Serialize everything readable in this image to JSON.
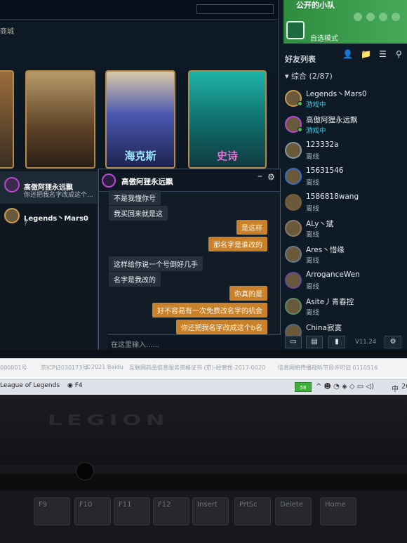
{
  "game": {
    "nav_label": "商城",
    "cards": [
      {
        "label": "",
        "color": "#c28c43"
      },
      {
        "label": "",
        "color": "#8a6b3b"
      },
      {
        "label": "海克斯",
        "color": "#5966b8"
      },
      {
        "label": "史诗",
        "color": "#1f9c96"
      }
    ]
  },
  "party": {
    "title": "公开的小队",
    "mode": "自选模式"
  },
  "friends": {
    "title": "好友列表",
    "group": "综合 (2/87)",
    "items": [
      {
        "name": "Legends丶Mars0",
        "status": "游戏中",
        "online": true
      },
      {
        "name": "高傲阿狸永远飘",
        "status": "游戏中",
        "online": true
      },
      {
        "name": "123332a",
        "status": "离线",
        "online": false
      },
      {
        "name": "15631546",
        "status": "离线",
        "online": false
      },
      {
        "name": "1586818wang",
        "status": "离线",
        "online": false
      },
      {
        "name": "ALy丶斌",
        "status": "离线",
        "online": false
      },
      {
        "name": "Ares丶惜缘",
        "status": "离线",
        "online": false
      },
      {
        "name": "ArroganceWen",
        "status": "离线",
        "online": false
      },
      {
        "name": "Asite丿青春控",
        "status": "离线",
        "online": false
      },
      {
        "name": "China寂寞",
        "status": "",
        "online": false
      }
    ]
  },
  "chat_list": [
    {
      "name": "高傲阿狸永远飘",
      "preview": "你还把我名字改成这个...",
      "active": true
    },
    {
      "name": "Legends丶Mars0",
      "preview": "?",
      "active": false
    }
  ],
  "chat": {
    "title": "高傲阿狸永远飘",
    "minimize": "–",
    "settings_icon": "gear-icon",
    "messages": [
      {
        "side": "l",
        "text": "不是我懂你号"
      },
      {
        "side": "l",
        "text": "我买回来就是这"
      },
      {
        "side": "r",
        "text": "是这样"
      },
      {
        "side": "r",
        "text": "那名字是谁改的"
      },
      {
        "side": "l",
        "text": "这样给你说一个号倒好几手"
      },
      {
        "side": "l",
        "text": "名字是我改的"
      },
      {
        "side": "r",
        "text": "你真的是"
      },
      {
        "side": "r",
        "text": "好不容易有一次免费改名字的机会"
      },
      {
        "side": "r",
        "text": "你还把我名字改成这个b名"
      }
    ],
    "input_placeholder": "在这里输入......",
    "version": "V11.24"
  },
  "legal": {
    "icp1": "000001号",
    "icp2": "京ICP证030173号",
    "copyright": "©2021 Baidu",
    "license": "互联网药品信息服务资格证书 (京)-经营性-2017-0020",
    "av": "信息网络传播视听节目许可证 0110516"
  },
  "taskbar": {
    "app1": "League of Legends",
    "app2": "F4",
    "battery": "58",
    "ime": "中",
    "clock": "20"
  },
  "laptop": {
    "brand": "LEGION",
    "keys": [
      "F9",
      "F10",
      "F11",
      "F12",
      "Insert",
      "PrtSc",
      "Delete",
      "Home"
    ]
  }
}
